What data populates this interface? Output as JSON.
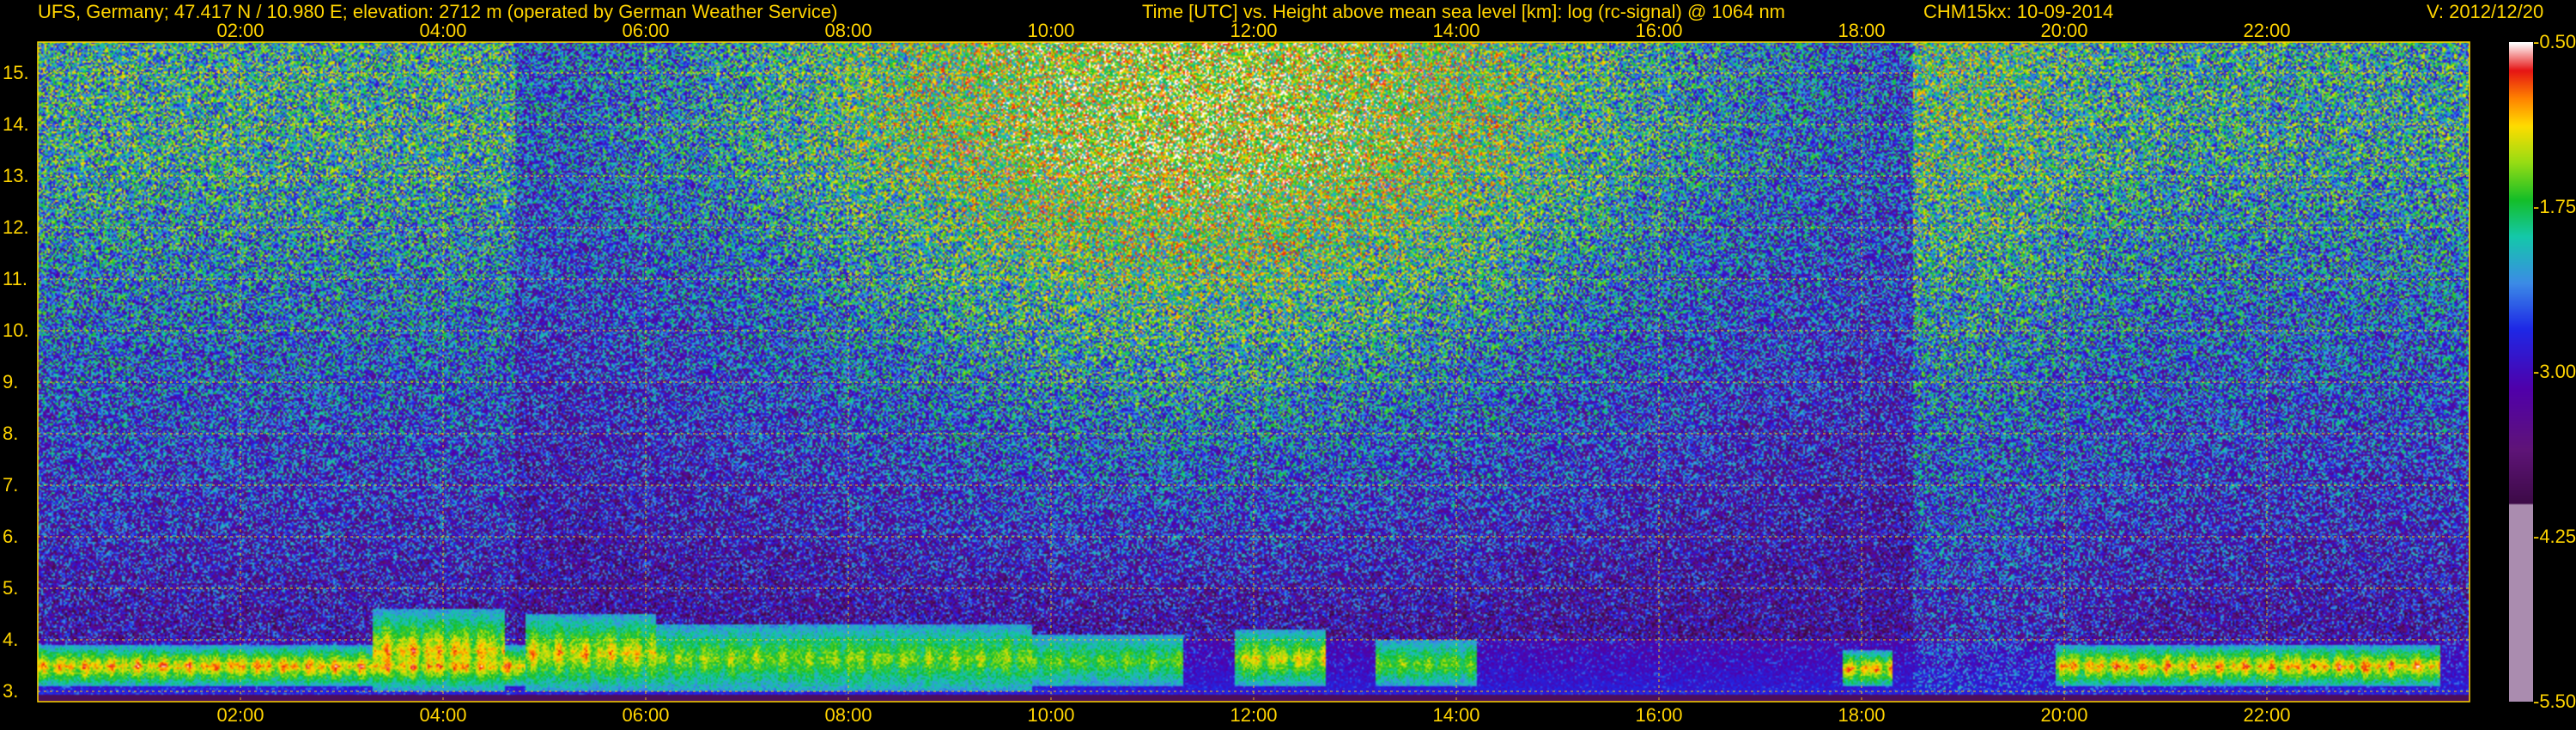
{
  "header": {
    "left": "UFS, Germany; 47.417 N / 10.980 E; elevation: 2712 m  (operated by German Weather Service)",
    "center": "Time [UTC] vs. Height above mean sea level [km]: log (rc-signal) @ 1064 nm",
    "instrument": "CHM15kx: 10-09-2014",
    "version": "V: 2012/12/20"
  },
  "chart_data": {
    "type": "heatmap",
    "title": "Time [UTC] vs. Height above mean sea level [km]: log (rc-signal) @ 1064 nm",
    "x_ticks": [
      "02:00",
      "04:00",
      "06:00",
      "08:00",
      "10:00",
      "12:00",
      "14:00",
      "16:00",
      "18:00",
      "20:00",
      "22:00"
    ],
    "x_tick_hours": [
      2,
      4,
      6,
      8,
      10,
      12,
      14,
      16,
      18,
      20,
      22
    ],
    "xlim_hours": [
      0,
      24
    ],
    "y_ticks": [
      "3.",
      "4.",
      "5.",
      "6.",
      "7.",
      "8.",
      "9.",
      "10.",
      "11.",
      "12.",
      "13.",
      "14.",
      "15."
    ],
    "y_tick_values": [
      3,
      4,
      5,
      6,
      7,
      8,
      9,
      10,
      11,
      12,
      13,
      14,
      15
    ],
    "ylim_km": [
      2.8,
      15.6
    ],
    "grid": true,
    "colorbar": {
      "labels": [
        "-0.50",
        "-1.75",
        "-3.00",
        "-4.25",
        "-5.50"
      ],
      "values": [
        -0.5,
        -1.75,
        -3.0,
        -4.25,
        -5.5
      ],
      "range": [
        -5.5,
        -0.5
      ]
    },
    "cloud_layers": [
      {
        "start_h": 0.0,
        "end_h": 4.8,
        "base_km": 3.1,
        "top_km": 3.9,
        "intensity": 0.9
      },
      {
        "start_h": 3.3,
        "end_h": 4.6,
        "base_km": 3.0,
        "top_km": 4.6,
        "intensity": 0.85
      },
      {
        "start_h": 4.8,
        "end_h": 6.1,
        "base_km": 3.0,
        "top_km": 4.5,
        "intensity": 0.8
      },
      {
        "start_h": 6.1,
        "end_h": 9.8,
        "base_km": 3.0,
        "top_km": 4.3,
        "intensity": 0.6
      },
      {
        "start_h": 9.8,
        "end_h": 11.3,
        "base_km": 3.1,
        "top_km": 4.1,
        "intensity": 0.5
      },
      {
        "start_h": 11.8,
        "end_h": 12.7,
        "base_km": 3.1,
        "top_km": 4.2,
        "intensity": 0.75
      },
      {
        "start_h": 13.2,
        "end_h": 14.2,
        "base_km": 3.1,
        "top_km": 4.0,
        "intensity": 0.55
      },
      {
        "start_h": 17.8,
        "end_h": 18.3,
        "base_km": 3.1,
        "top_km": 3.8,
        "intensity": 0.9
      },
      {
        "start_h": 19.9,
        "end_h": 23.7,
        "base_km": 3.1,
        "top_km": 3.9,
        "intensity": 0.9
      }
    ]
  }
}
